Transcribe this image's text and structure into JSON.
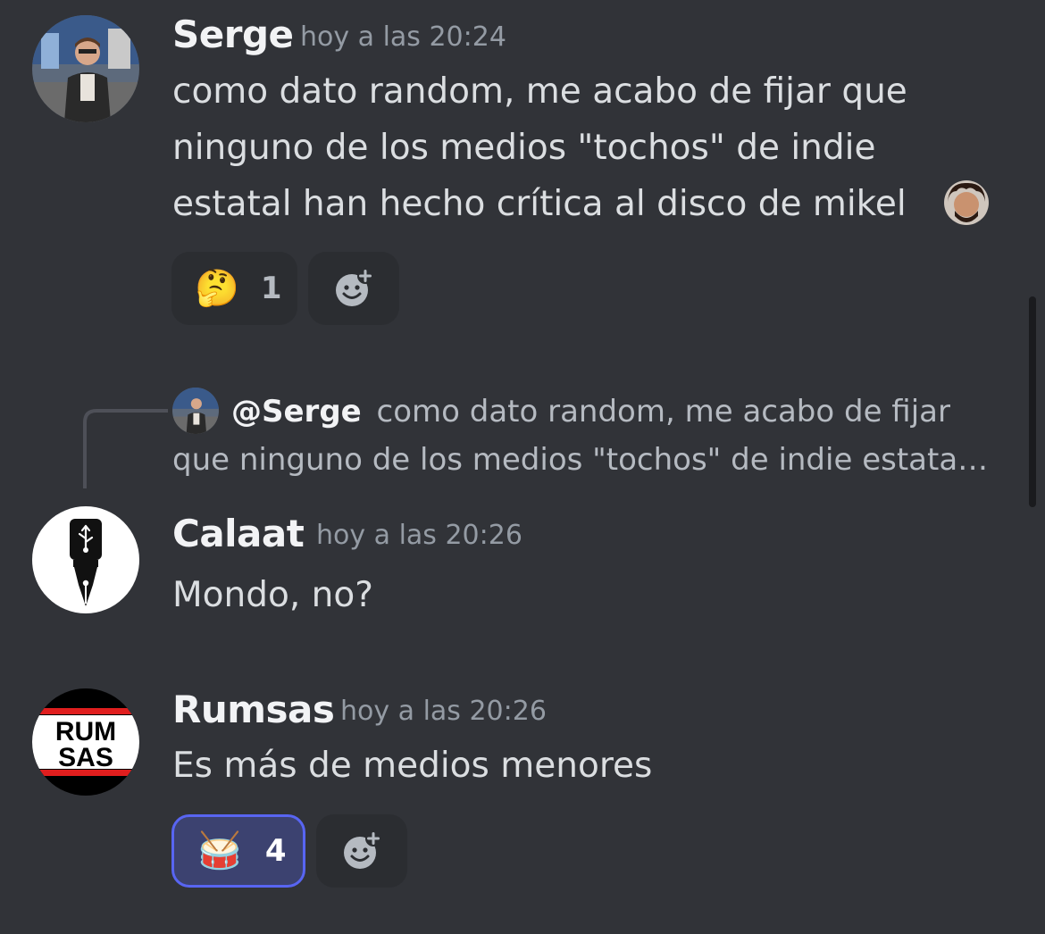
{
  "messages": [
    {
      "author": "Serge",
      "timestamp": "hoy a las 20:24",
      "lines": [
        "como dato random, me acabo de fijar que",
        "ninguno de los medios \"tochos\" de indie",
        "estatal han hecho crítica al disco de mikel"
      ],
      "reactions": [
        {
          "emoji": "🤔",
          "count": "1",
          "active": false
        }
      ]
    },
    {
      "author": "Calaat",
      "timestamp": "hoy a las 20:26",
      "reply_to": {
        "mention": "@Serge",
        "line1": "como dato random, me acabo de fijar",
        "line2": "que ninguno de los medios \"tochos\" de indie estata…"
      },
      "lines": [
        "Mondo, no?"
      ]
    },
    {
      "author": "Rumsas",
      "timestamp": "hoy a las 20:26",
      "lines": [
        "Es más de medios menores"
      ],
      "avatar_text": [
        "RUM",
        "SAS"
      ],
      "reactions": [
        {
          "emoji": "🥁",
          "count": "4",
          "active": true
        }
      ]
    }
  ],
  "icons": {
    "add_reaction": "add-reaction-icon",
    "custom_emoji": "custom-emoji-icon"
  },
  "colors": {
    "background": "#313338",
    "accent": "#5865f2",
    "muted": "#949ba4"
  }
}
